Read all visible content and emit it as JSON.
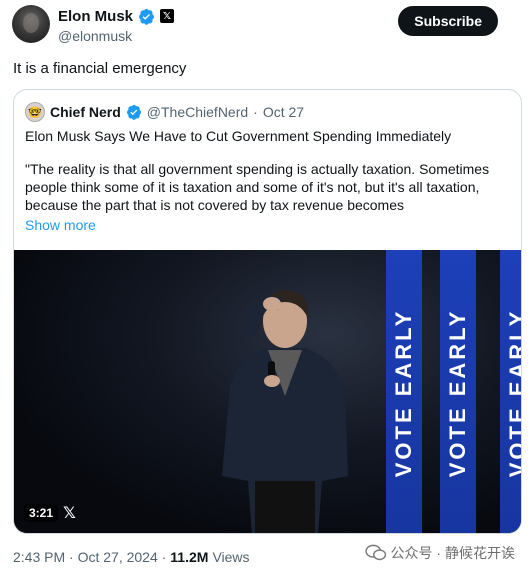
{
  "tweet": {
    "author_name": "Elon Musk",
    "author_handle": "@elonmusk",
    "subscribe_label": "Subscribe",
    "text": "It is a financial emergency",
    "timestamp": "2:43 PM · Oct 27, 2024 · ",
    "views_count": "11.2M",
    "views_label": "Views"
  },
  "quote": {
    "author_name": "Chief Nerd",
    "author_handle": "@TheChiefNerd",
    "date": "Oct 27",
    "title": "Elon Musk Says We Have to Cut Government Spending Immediately",
    "body": "\"The reality is that all government spending is actually taxation. Sometimes people think some of it is taxation and some of it's not, but it's all taxation, because the part that is not covered by tax revenue becomes",
    "show_more": "Show more",
    "media": {
      "duration": "3:21",
      "banner_text": "VOTE EARLY"
    }
  },
  "watermark": {
    "text": "公众号 · 静候花开诶"
  },
  "colors": {
    "verified_blue": "#1d9bf0",
    "banner_blue": "#1d3fb8",
    "text_primary": "#0f1419",
    "text_secondary": "#536471"
  }
}
